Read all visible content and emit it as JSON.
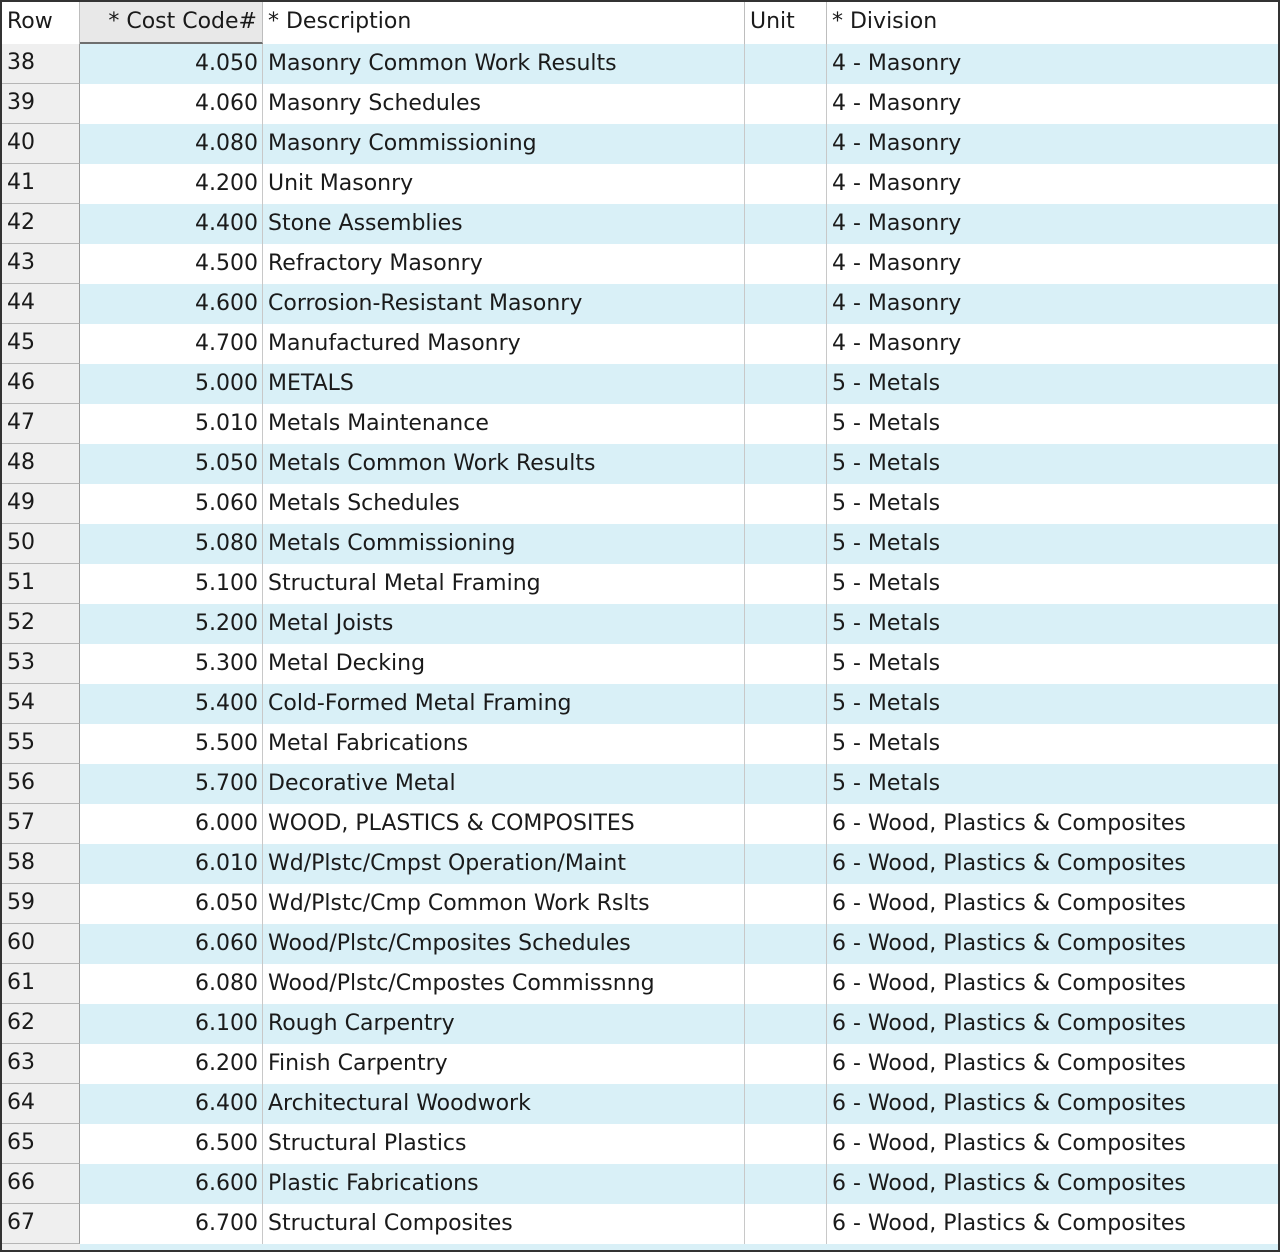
{
  "columns": {
    "row": "Row",
    "code": "* Cost Code#",
    "description": "* Description",
    "unit": "Unit",
    "division": "* Division"
  },
  "rows": [
    {
      "row": "38",
      "code": "4.050",
      "description": "Masonry Common Work Results",
      "unit": "",
      "division": "4 - Masonry"
    },
    {
      "row": "39",
      "code": "4.060",
      "description": "Masonry Schedules",
      "unit": "",
      "division": "4 - Masonry"
    },
    {
      "row": "40",
      "code": "4.080",
      "description": "Masonry Commissioning",
      "unit": "",
      "division": "4 - Masonry"
    },
    {
      "row": "41",
      "code": "4.200",
      "description": "Unit Masonry",
      "unit": "",
      "division": "4 - Masonry"
    },
    {
      "row": "42",
      "code": "4.400",
      "description": "Stone Assemblies",
      "unit": "",
      "division": "4 - Masonry"
    },
    {
      "row": "43",
      "code": "4.500",
      "description": "Refractory Masonry",
      "unit": "",
      "division": "4 - Masonry"
    },
    {
      "row": "44",
      "code": "4.600",
      "description": "Corrosion-Resistant Masonry",
      "unit": "",
      "division": "4 - Masonry"
    },
    {
      "row": "45",
      "code": "4.700",
      "description": "Manufactured Masonry",
      "unit": "",
      "division": "4 - Masonry"
    },
    {
      "row": "46",
      "code": "5.000",
      "description": "METALS",
      "unit": "",
      "division": "5 - Metals"
    },
    {
      "row": "47",
      "code": "5.010",
      "description": "Metals Maintenance",
      "unit": "",
      "division": "5 - Metals"
    },
    {
      "row": "48",
      "code": "5.050",
      "description": "Metals Common Work Results",
      "unit": "",
      "division": "5 - Metals"
    },
    {
      "row": "49",
      "code": "5.060",
      "description": "Metals Schedules",
      "unit": "",
      "division": "5 - Metals"
    },
    {
      "row": "50",
      "code": "5.080",
      "description": "Metals Commissioning",
      "unit": "",
      "division": "5 - Metals"
    },
    {
      "row": "51",
      "code": "5.100",
      "description": "Structural Metal Framing",
      "unit": "",
      "division": "5 - Metals"
    },
    {
      "row": "52",
      "code": "5.200",
      "description": "Metal Joists",
      "unit": "",
      "division": "5 - Metals"
    },
    {
      "row": "53",
      "code": "5.300",
      "description": "Metal Decking",
      "unit": "",
      "division": "5 - Metals"
    },
    {
      "row": "54",
      "code": "5.400",
      "description": "Cold-Formed Metal Framing",
      "unit": "",
      "division": "5 - Metals"
    },
    {
      "row": "55",
      "code": "5.500",
      "description": "Metal Fabrications",
      "unit": "",
      "division": "5 - Metals"
    },
    {
      "row": "56",
      "code": "5.700",
      "description": "Decorative Metal",
      "unit": "",
      "division": "5 - Metals"
    },
    {
      "row": "57",
      "code": "6.000",
      "description": "WOOD, PLASTICS & COMPOSITES",
      "unit": "",
      "division": "6 - Wood, Plastics & Composites"
    },
    {
      "row": "58",
      "code": "6.010",
      "description": "Wd/Plstc/Cmpst Operation/Maint",
      "unit": "",
      "division": "6 - Wood, Plastics & Composites"
    },
    {
      "row": "59",
      "code": "6.050",
      "description": "Wd/Plstc/Cmp Common Work Rslts",
      "unit": "",
      "division": "6 - Wood, Plastics & Composites"
    },
    {
      "row": "60",
      "code": "6.060",
      "description": "Wood/Plstc/Cmposites Schedules",
      "unit": "",
      "division": "6 - Wood, Plastics & Composites"
    },
    {
      "row": "61",
      "code": "6.080",
      "description": "Wood/Plstc/Cmpostes Commissnng",
      "unit": "",
      "division": "6 - Wood, Plastics & Composites"
    },
    {
      "row": "62",
      "code": "6.100",
      "description": "Rough Carpentry",
      "unit": "",
      "division": "6 - Wood, Plastics & Composites"
    },
    {
      "row": "63",
      "code": "6.200",
      "description": "Finish Carpentry",
      "unit": "",
      "division": "6 - Wood, Plastics & Composites"
    },
    {
      "row": "64",
      "code": "6.400",
      "description": "Architectural Woodwork",
      "unit": "",
      "division": "6 - Wood, Plastics & Composites"
    },
    {
      "row": "65",
      "code": "6.500",
      "description": "Structural Plastics",
      "unit": "",
      "division": "6 - Wood, Plastics & Composites"
    },
    {
      "row": "66",
      "code": "6.600",
      "description": "Plastic Fabrications",
      "unit": "",
      "division": "6 - Wood, Plastics & Composites"
    },
    {
      "row": "67",
      "code": "6.700",
      "description": "Structural Composites",
      "unit": "",
      "division": "6 - Wood, Plastics & Composites"
    }
  ],
  "colors": {
    "row_alt": "#d9f0f7",
    "row_plain": "#ffffff",
    "row_header": "#efefef"
  }
}
